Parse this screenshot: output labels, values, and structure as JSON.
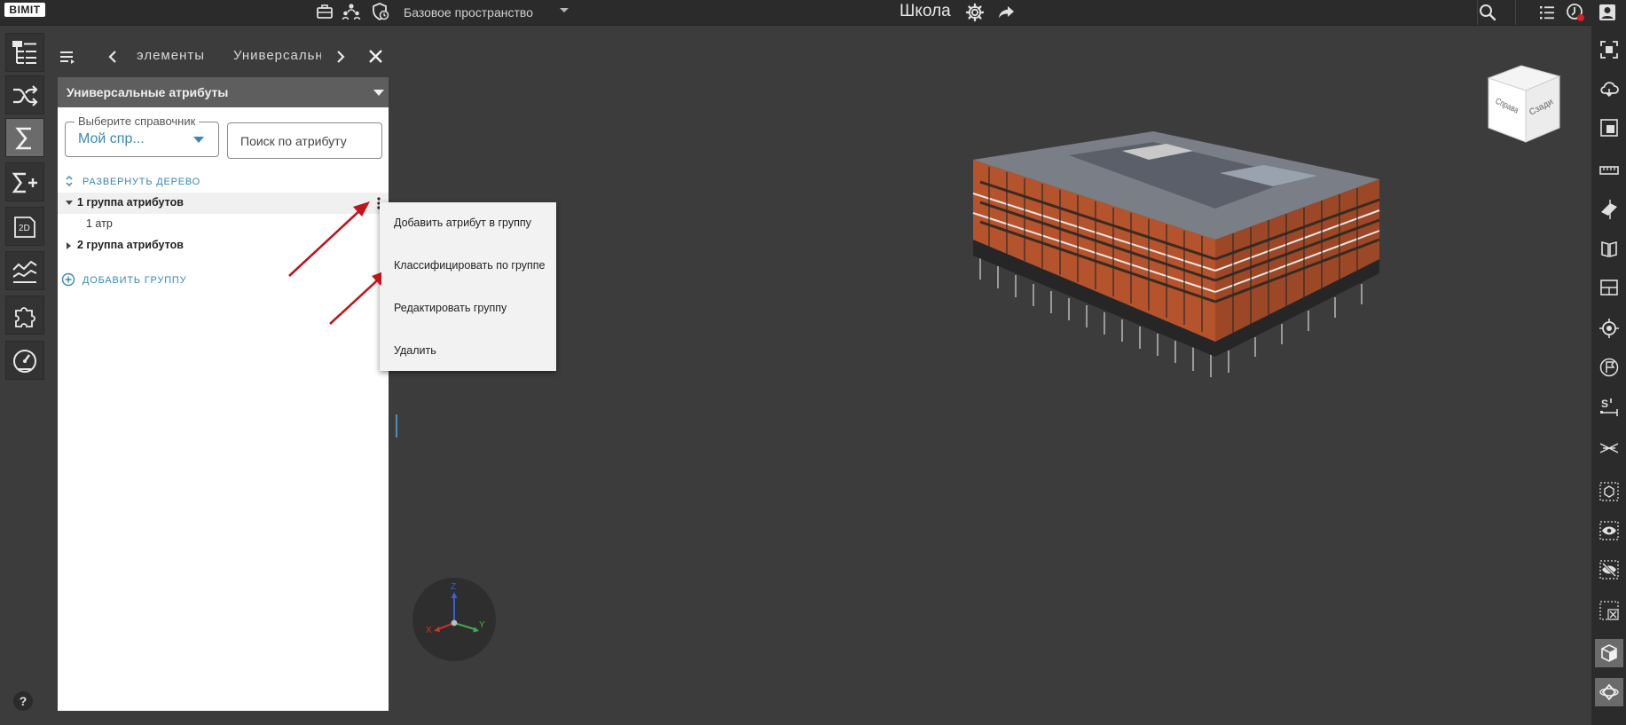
{
  "topbar": {
    "logo": "BIMIT",
    "space_selector": "Базовое пространство",
    "title": "Школа"
  },
  "panel": {
    "tabs": {
      "prev": "элементы",
      "active": "Универсальн"
    },
    "header_title": "Универсальные атрибуты",
    "reference": {
      "label": "Выберите справочник",
      "value": "Мой спр..."
    },
    "search_placeholder": "Поиск по атрибуту",
    "expand_tree": "РАЗВЕРНУТЬ ДЕРЕВО",
    "tree": [
      {
        "label": "1 группа атрибутов",
        "expanded": true,
        "children": [
          "1 атр"
        ]
      },
      {
        "label": "2 группа атрибутов",
        "expanded": false,
        "children": []
      }
    ],
    "add_group": "ДОБАВИТЬ ГРУППУ"
  },
  "context_menu": [
    "Добавить атрибут в группу",
    "Классифицировать по группе",
    "Редактировать группу",
    "Удалить"
  ],
  "viewcube": {
    "left_face": "Справа",
    "front_face": "Сзади"
  },
  "axes": {
    "z": "Z",
    "x": "X",
    "y": "Y"
  },
  "help": "?",
  "colors": {
    "accent": "#3a86b4",
    "building": "#b4532c",
    "annotation_arrow": "#c0151b"
  },
  "icons": {
    "left_rail": [
      "tree-structure-icon",
      "shuffle-icon",
      "sigma-icon",
      "sigma-plus-icon",
      "2d-sheet-icon",
      "chart-lines-icon",
      "puzzle-icon",
      "gauge-icon"
    ],
    "right_rail": [
      "focus-icon",
      "cloud-icon",
      "section-box-icon",
      "ruler-icon",
      "plane-cut-icon",
      "book-icon",
      "layout-icon",
      "target-icon",
      "flag-icon",
      "s-measure-icon",
      "crossed-lines-icon",
      "cube-select-icon",
      "eye-icon",
      "eye-off-icon",
      "box-close-icon",
      "solid-cube-icon",
      "orbit-icon"
    ]
  }
}
